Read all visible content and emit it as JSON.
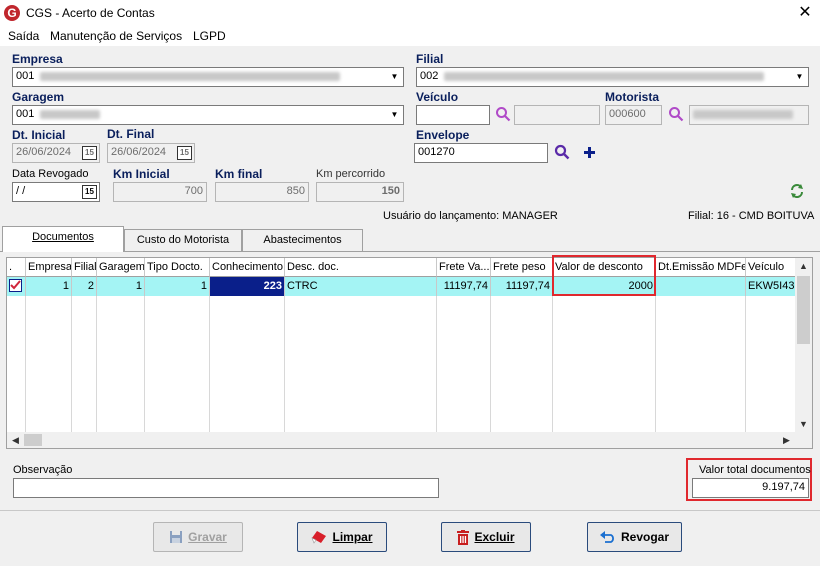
{
  "window": {
    "title": "CGS - Acerto de Contas",
    "close": "✕",
    "app_icon": "G"
  },
  "menu": [
    "Saída",
    "Manutenção de Serviços",
    "LGPD"
  ],
  "form": {
    "empresa_label": "Empresa",
    "empresa_value": "001",
    "filial_label": "Filial",
    "filial_value": "002",
    "garagem_label": "Garagem",
    "garagem_value": "001",
    "veiculo_label": "Veículo",
    "veiculo_value": "",
    "motorista_label": "Motorista",
    "motorista_value": "000600",
    "dt_inicial_label": "Dt. Inicial",
    "dt_inicial_value": "26/06/2024",
    "dt_final_label": "Dt. Final",
    "dt_final_value": "26/06/2024",
    "envelope_label": "Envelope",
    "envelope_value": "001270",
    "data_revogado_label": "Data Revogado",
    "data_revogado_value": " / /",
    "km_inicial_label": "Km Inicial",
    "km_inicial_value": "700",
    "km_final_label": "Km final",
    "km_final_value": "850",
    "km_percorrido_label": "Km percorrido",
    "km_percorrido_value": "150",
    "calendar_day": "15",
    "usuario_text": "Usuário do lançamento: MANAGER",
    "filial_text": "Filial: 16 - CMD BOITUVA"
  },
  "tabs": [
    "Documentos",
    "Custo do Motorista",
    "Abastecimentos"
  ],
  "grid": {
    "headers": [
      ".",
      "Empresa",
      "Filial",
      "Garagem",
      "Tipo Docto.",
      "Conhecimento",
      "Desc. doc.",
      "Frete Va...",
      "Frete peso",
      "Valor de desconto",
      "Dt.Emissão MDFe",
      "Veículo"
    ],
    "row": {
      "empresa": "1",
      "filial": "2",
      "garagem": "1",
      "tipo_docto": "1",
      "conhecimento": "223",
      "desc_doc": "CTRC",
      "frete_valor": "11197,74",
      "frete_peso": "11197,74",
      "valor_desconto": "2000",
      "dt_emissao": "",
      "veiculo": "EKW5I43"
    }
  },
  "observacao_label": "Observação",
  "observacao_value": "",
  "valor_total_label": "Valor total documentos",
  "valor_total_value": "9.197,74",
  "buttons": {
    "gravar": "Gravar",
    "limpar": "Limpar",
    "excluir": "Excluir",
    "revogar": "Revogar"
  },
  "colors": {
    "highlight_row": "#a4f4f4",
    "selected_cell": "#0a1f8a",
    "label_blue": "#0a1f5c",
    "red_box": "#e0282e"
  }
}
